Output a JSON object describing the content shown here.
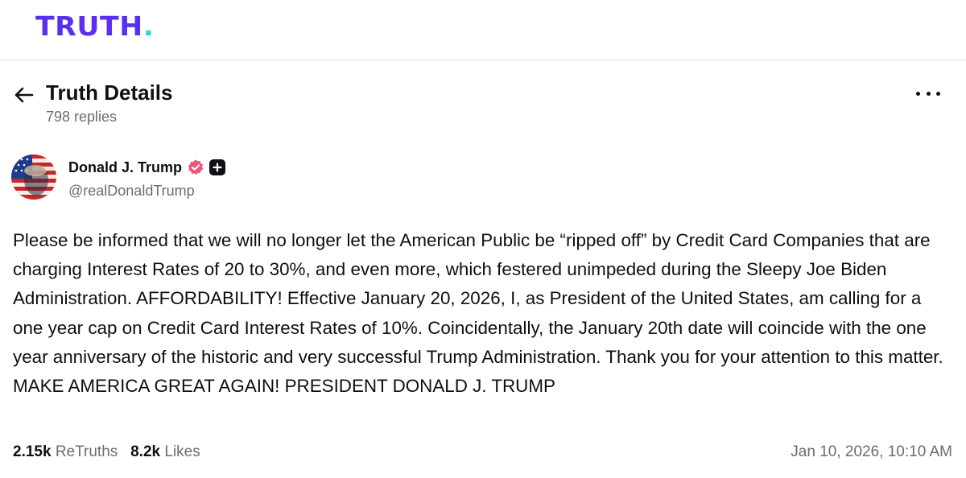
{
  "app": {
    "logo_text": "TRUTH",
    "logo_dot": ".",
    "brand_color": "#5b2ff0",
    "accent_color": "#2dd4bf"
  },
  "header": {
    "title": "Truth Details",
    "reply_count": "798 replies",
    "back_icon": "arrow-left-icon",
    "more_icon": "more-horizontal-icon"
  },
  "post": {
    "author": {
      "name": "Donald J. Trump",
      "handle": "@realDonaldTrump",
      "verified_color": "#e8587a",
      "verified_icon": "verified-badge-icon",
      "plus_icon": "plus-badge-icon"
    },
    "body": "Please be informed that we will no longer let the American Public be “ripped off” by Credit Card Companies that are charging Interest Rates of 20 to 30%, and even more, which festered unimpeded during the Sleepy Joe Biden Administration. AFFORDABILITY! Effective January 20, 2026, I, as President of the United States, am calling for a one year cap on Credit Card Interest Rates of 10%. Coincidentally, the January 20th date will coincide with the one year anniversary of the historic and very successful Trump Administration. Thank you for your attention to this matter. MAKE AMERICA GREAT AGAIN! PRESIDENT DONALD J. TRUMP",
    "stats": {
      "retruths_count": "2.15k",
      "retruths_label": "ReTruths",
      "likes_count": "8.2k",
      "likes_label": "Likes"
    },
    "timestamp": "Jan 10, 2026, 10:10 AM"
  }
}
